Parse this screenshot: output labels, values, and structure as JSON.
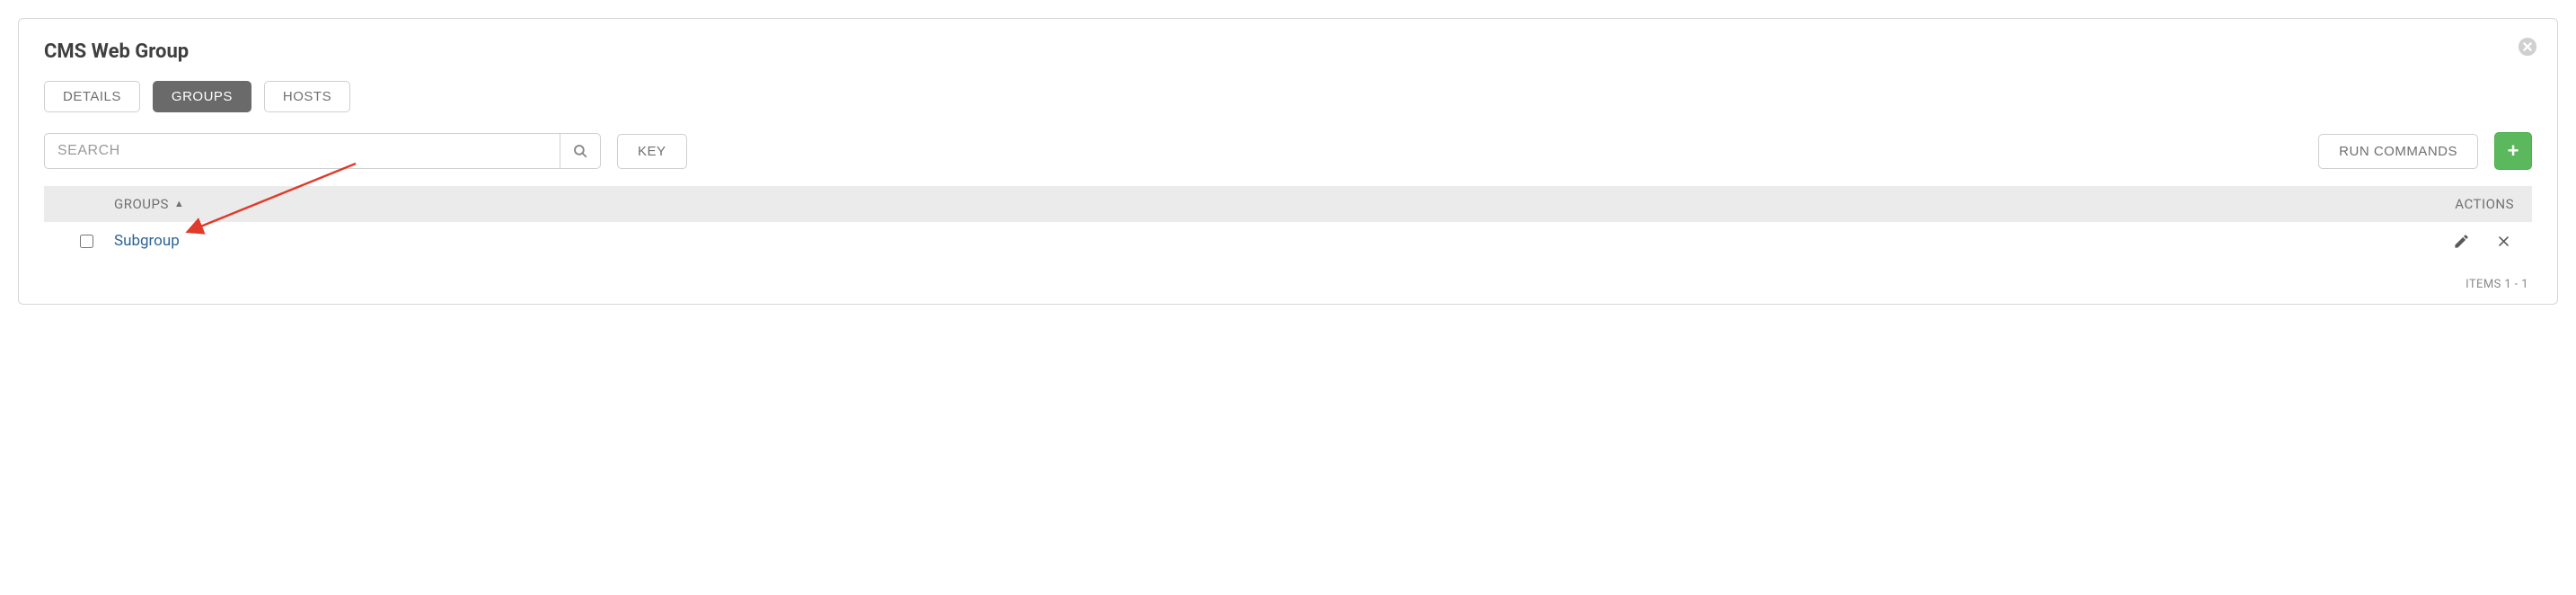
{
  "panel": {
    "title": "CMS Web Group"
  },
  "tabs": {
    "details": "DETAILS",
    "groups": "GROUPS",
    "hosts": "HOSTS"
  },
  "toolbar": {
    "search_placeholder": "SEARCH",
    "key_label": "KEY",
    "run_commands_label": "RUN COMMANDS",
    "add_label": "+"
  },
  "table": {
    "header_groups": "GROUPS",
    "header_actions": "ACTIONS",
    "rows": [
      {
        "name": "Subgroup"
      }
    ]
  },
  "footer": {
    "items_label": "ITEMS  1 - 1"
  }
}
